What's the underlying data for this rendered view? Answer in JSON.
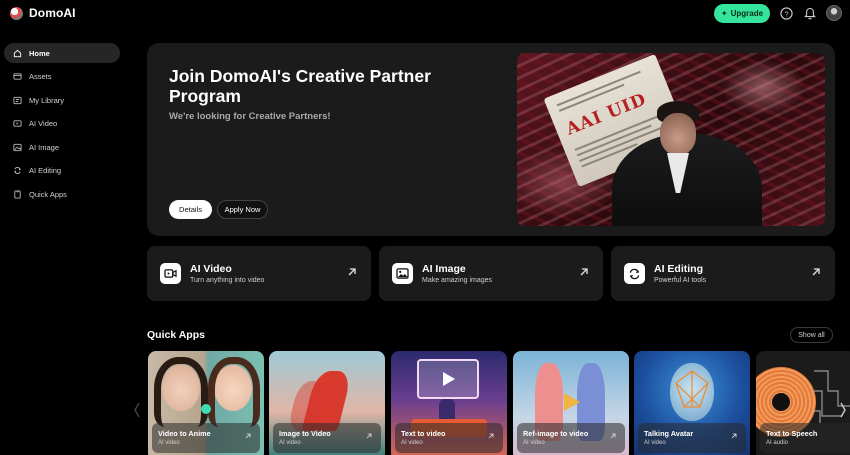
{
  "header": {
    "brand": "DomoAI",
    "upgrade_label": "Upgrade"
  },
  "sidebar": {
    "items": [
      {
        "label": "Home",
        "icon": "home-icon",
        "active": true
      },
      {
        "label": "Assets",
        "icon": "assets-icon"
      },
      {
        "label": "My Library",
        "icon": "library-icon"
      },
      {
        "label": "AI Video",
        "icon": "video-icon"
      },
      {
        "label": "AI Image",
        "icon": "image-icon"
      },
      {
        "label": "AI Editing",
        "icon": "editing-icon"
      },
      {
        "label": "Quick Apps",
        "icon": "apps-icon"
      }
    ]
  },
  "hero": {
    "title": "Join DomoAI's Creative Partner Program",
    "subtitle": "We're looking for Creative Partners!",
    "details_label": "Details",
    "apply_label": "Apply Now",
    "image_headline": "AAI UID"
  },
  "features": [
    {
      "title": "AI Video",
      "subtitle": "Turn anything into video",
      "icon": "video-camera-icon"
    },
    {
      "title": "AI Image",
      "subtitle": "Make amazing images",
      "icon": "picture-icon"
    },
    {
      "title": "AI Editing",
      "subtitle": "Powerful AI tools",
      "icon": "refresh-edit-icon"
    }
  ],
  "quick_apps": {
    "title": "Quick Apps",
    "show_all_label": "Show all",
    "items": [
      {
        "label": "Video to Anime",
        "meta": "AI video"
      },
      {
        "label": "Image to Video",
        "meta": "AI video"
      },
      {
        "label": "Text to video",
        "meta": "AI video"
      },
      {
        "label": "Ref-image to video",
        "meta": "AI video"
      },
      {
        "label": "Talking Avatar",
        "meta": "AI video"
      },
      {
        "label": "Text to Speech",
        "meta": "AI audio"
      }
    ]
  },
  "colors": {
    "accent": "#35e59b",
    "card_bg": "#1b1b1b",
    "page_bg": "#000000"
  }
}
